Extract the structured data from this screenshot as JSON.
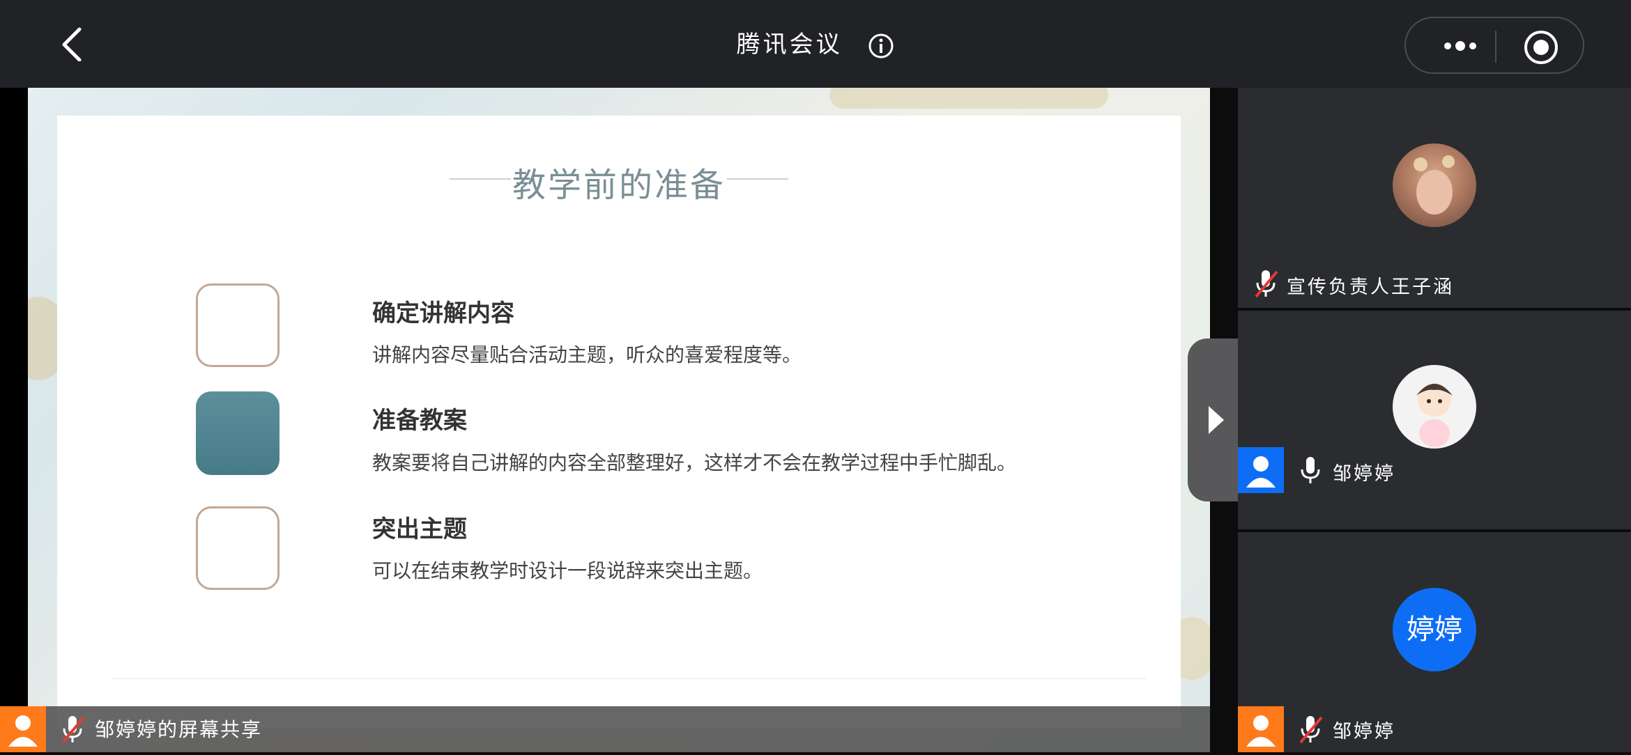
{
  "header": {
    "title": "腾讯会议",
    "back_icon": "chevron-left-icon",
    "info_icon": "info-icon",
    "more_icon": "more-dots-icon",
    "record_icon": "record-icon"
  },
  "slide": {
    "title": "教学前的准备",
    "items": [
      {
        "heading": "确定讲解内容",
        "description": "讲解内容尽量贴合活动主题，听众的喜爱程度等。"
      },
      {
        "heading": "准备教案",
        "description": "教案要将自己讲解的内容全部整理好，这样才不会在教学过程中手忙脚乱。"
      },
      {
        "heading": "突出主题",
        "description": "可以在结束教学时设计一段说辞来突出主题。"
      }
    ]
  },
  "share_bar": {
    "label": "邹婷婷的屏幕共享",
    "mic_state": "muted"
  },
  "participants": [
    {
      "name": "宣传负责人王子涵",
      "mic_state": "muted",
      "avatar": "photo"
    },
    {
      "name": "邹婷婷",
      "mic_state": "on",
      "avatar": "cartoon"
    },
    {
      "name": "邹婷婷",
      "mic_state": "muted",
      "avatar_text": "婷婷"
    }
  ],
  "colors": {
    "accent_blue": "#0d6ef5",
    "accent_orange": "#ff7a1a",
    "muted_red": "#e53935"
  }
}
